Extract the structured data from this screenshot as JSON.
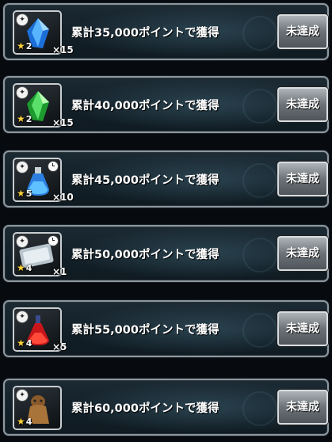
{
  "rewards": [
    {
      "label": "累計35,000ポイントで獲得",
      "stars": "2",
      "qty": "×15",
      "item_icon": "blue-crystal",
      "status": "未達成",
      "timer": false
    },
    {
      "label": "累計40,000ポイントで獲得",
      "stars": "2",
      "qty": "×15",
      "item_icon": "green-crystal",
      "status": "未達成",
      "timer": false
    },
    {
      "label": "累計45,000ポイントで獲得",
      "stars": "5",
      "qty": "×10",
      "item_icon": "potion-bottle",
      "status": "未達成",
      "timer": true
    },
    {
      "label": "累計50,000ポイントで獲得",
      "stars": "4",
      "qty": "×1",
      "item_icon": "ticket",
      "status": "未達成",
      "timer": true
    },
    {
      "label": "累計55,000ポイントで獲得",
      "stars": "4",
      "qty": "×5",
      "item_icon": "red-elixir",
      "status": "未達成",
      "timer": false
    },
    {
      "label": "累計60,000ポイントで獲得",
      "stars": "4",
      "qty": "",
      "item_icon": "beast-figure",
      "status": "未達成",
      "timer": false
    }
  ],
  "colors": {
    "star": "#ffd23c",
    "button": "#7a8287",
    "frame": "#8d979f"
  }
}
